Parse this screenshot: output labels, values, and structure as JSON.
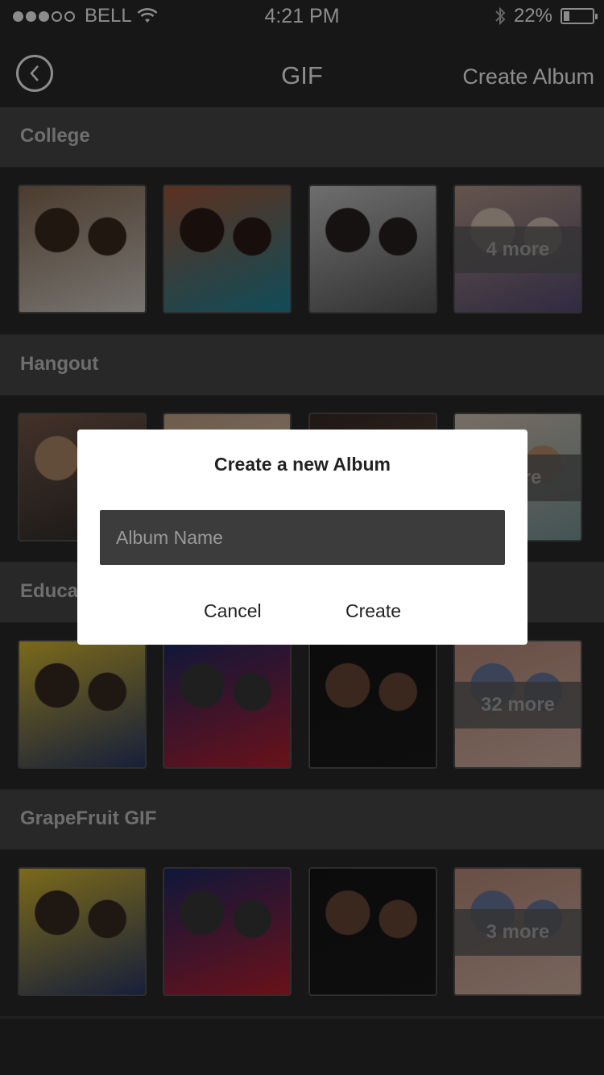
{
  "status_bar": {
    "carrier": "BELL",
    "time": "4:21 PM",
    "battery": "22%",
    "battery_level": 0.22,
    "signal_dots": [
      true,
      true,
      true,
      false,
      false
    ]
  },
  "nav": {
    "title": "GIF",
    "create_album": "Create Album"
  },
  "albums": [
    {
      "name": "College",
      "more_label": "4 more",
      "thumbs": [
        {
          "colors": [
            "#8a6d55",
            "#3d2a1f",
            "#d9d4cc"
          ]
        },
        {
          "colors": [
            "#a85a3a",
            "#2c1c16",
            "#1f8aa0"
          ]
        },
        {
          "colors": [
            "#c8c8c8",
            "#2a2222",
            "#5a5a5a"
          ]
        },
        {
          "colors": [
            "#b69b8a",
            "#d9c7b9",
            "#5a4e77"
          ]
        }
      ]
    },
    {
      "name": "Hangout",
      "more_label": "more",
      "thumbs": [
        {
          "colors": [
            "#7a5a4a",
            "#b38a6b",
            "#2c2c2c"
          ]
        },
        {
          "colors": [
            "#c9a98a",
            "#3b2a22",
            "#e0d0c0"
          ]
        },
        {
          "colors": [
            "#3a2c26",
            "#b08060",
            "#6a5048"
          ]
        },
        {
          "colors": [
            "#d8c8b8",
            "#c09070",
            "#7a9a9a"
          ]
        }
      ]
    },
    {
      "name": "Education",
      "more_label": "32 more",
      "thumbs": [
        {
          "colors": [
            "#e0c030",
            "#3a2a20",
            "#2a3a6a"
          ]
        },
        {
          "colors": [
            "#1e2a6a",
            "#3a3a3a",
            "#c02030"
          ]
        },
        {
          "colors": [
            "#151515",
            "#6a4a3a",
            "#1a1a1a"
          ]
        },
        {
          "colors": [
            "#c09080",
            "#6a7aa0",
            "#d8b8a8"
          ]
        }
      ]
    },
    {
      "name": "GrapeFruit GIF",
      "more_label": "3 more",
      "thumbs": [
        {
          "colors": [
            "#e0c030",
            "#3a2a20",
            "#2a3a6a"
          ]
        },
        {
          "colors": [
            "#1e2a6a",
            "#3a3a3a",
            "#c02030"
          ]
        },
        {
          "colors": [
            "#151515",
            "#6a4a3a",
            "#1a1a1a"
          ]
        },
        {
          "colors": [
            "#c09080",
            "#6a7aa0",
            "#d8b8a8"
          ]
        }
      ]
    }
  ],
  "dialog": {
    "title": "Create a new Album",
    "input_placeholder": "Album Name",
    "input_value": "",
    "cancel": "Cancel",
    "create": "Create"
  }
}
